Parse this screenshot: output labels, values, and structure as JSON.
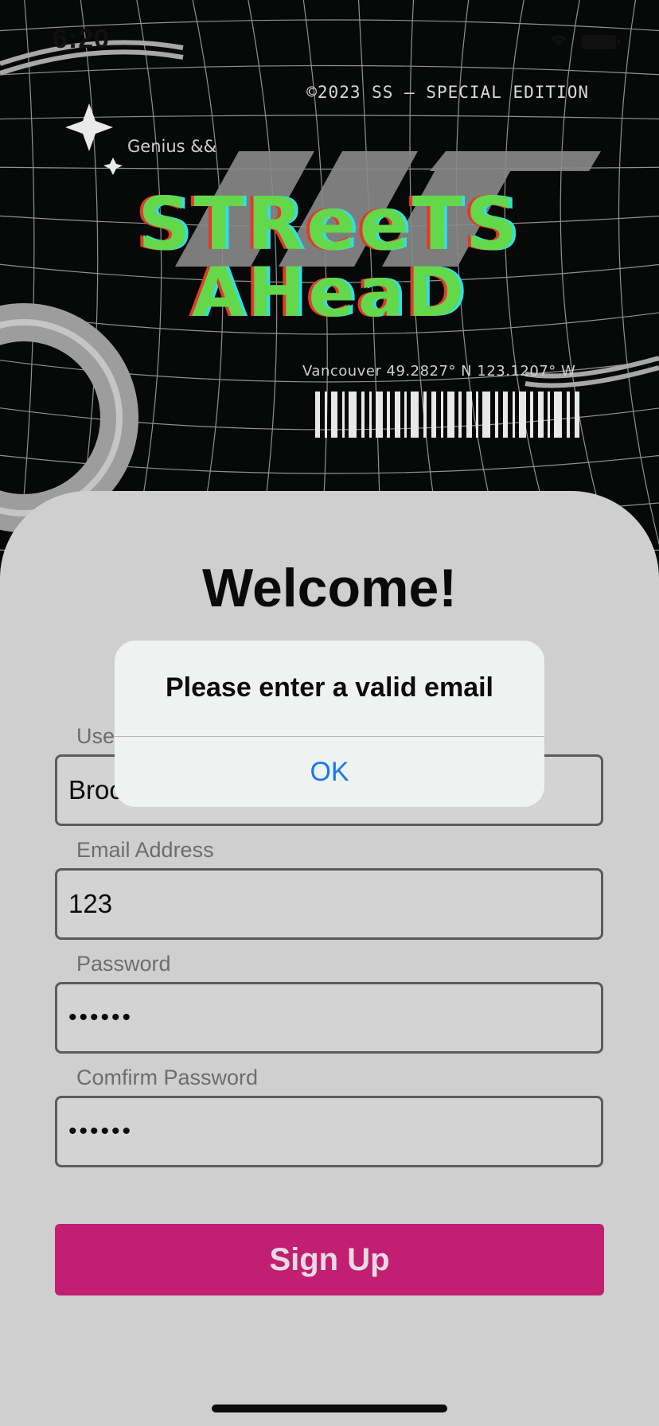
{
  "status_bar": {
    "time": "6:20"
  },
  "poster": {
    "copyright": "©2023 SS — SPECIAL EDITION",
    "brand": "Genius &&",
    "title_line1": "STReeTS",
    "title_line2": "AHeaD",
    "coordinates": "Vancouver 49.2827° N 123.1207° W"
  },
  "form": {
    "heading": "Welcome!",
    "username": {
      "label": "Use",
      "value": "Broc"
    },
    "email": {
      "label": "Email Address",
      "value": "123"
    },
    "password": {
      "label": "Password",
      "value": "••••••"
    },
    "confirm_password": {
      "label": "Comfirm Password",
      "value": "••••••"
    },
    "submit_label": "Sign Up"
  },
  "alert": {
    "message": "Please enter a valid email",
    "ok_label": "OK"
  },
  "colors": {
    "sheet": "#cfcfcf",
    "button": "#c21f73",
    "link_blue": "#1877f2",
    "title_green": "#62d84a"
  }
}
